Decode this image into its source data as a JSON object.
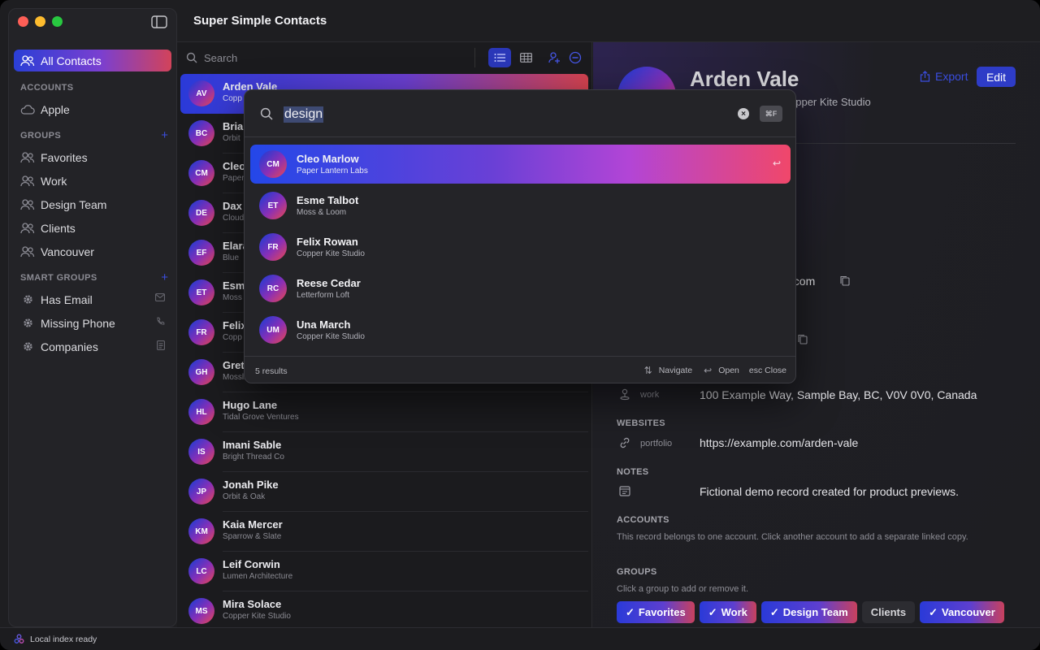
{
  "app": {
    "title": "Super Simple Contacts"
  },
  "sidebar": {
    "all_contacts": "All Contacts",
    "accounts_header": "ACCOUNTS",
    "accounts": [
      {
        "label": "Apple",
        "icon": "cloud-icon"
      }
    ],
    "groups_header": "GROUPS",
    "groups": [
      {
        "label": "Favorites",
        "icon": "people-icon"
      },
      {
        "label": "Work",
        "icon": "people-icon"
      },
      {
        "label": "Design Team",
        "icon": "people-icon"
      },
      {
        "label": "Clients",
        "icon": "people-icon"
      },
      {
        "label": "Vancouver",
        "icon": "people-icon"
      }
    ],
    "smart_groups_header": "SMART GROUPS",
    "smart_groups": [
      {
        "label": "Has Email",
        "icon": "gear-icon",
        "trail_icon": "envelope-icon"
      },
      {
        "label": "Missing Phone",
        "icon": "gear-icon",
        "trail_icon": "phone-icon"
      },
      {
        "label": "Companies",
        "icon": "gear-icon",
        "trail_icon": "document-icon"
      }
    ]
  },
  "list": {
    "search_placeholder": "Search",
    "contacts": [
      {
        "initials": "AV",
        "name": "Arden Vale",
        "company": "Copp"
      },
      {
        "initials": "BC",
        "name": "Brian",
        "company": "Orbit"
      },
      {
        "initials": "CM",
        "name": "Cleo",
        "company": "Paper"
      },
      {
        "initials": "DE",
        "name": "Dax",
        "company": "Cloud"
      },
      {
        "initials": "EF",
        "name": "Elara",
        "company": "Blue"
      },
      {
        "initials": "ET",
        "name": "Esm",
        "company": "Moss"
      },
      {
        "initials": "FR",
        "name": "Felix",
        "company": "Copp"
      },
      {
        "initials": "GH",
        "name": "Gret",
        "company": "Mossli"
      },
      {
        "initials": "HL",
        "name": "Hugo Lane",
        "company": "Tidal Grove Ventures"
      },
      {
        "initials": "IS",
        "name": "Imani Sable",
        "company": "Bright Thread Co"
      },
      {
        "initials": "JP",
        "name": "Jonah Pike",
        "company": "Orbit & Oak"
      },
      {
        "initials": "KM",
        "name": "Kaia Mercer",
        "company": "Sparrow & Slate"
      },
      {
        "initials": "LC",
        "name": "Leif Corwin",
        "company": "Lumen Architecture"
      },
      {
        "initials": "MS",
        "name": "Mira Solace",
        "company": "Copper Kite Studio"
      }
    ]
  },
  "detail": {
    "name": "Arden Vale",
    "company_fragment": "opper Kite Studio",
    "export_label": "Export",
    "edit_label": "Edit",
    "email_fragment": "le.com",
    "address": {
      "label": "work",
      "value": "100 Example Way, Sample Bay, BC, V0V 0V0, Canada"
    },
    "websites_header": "WEBSITES",
    "website": {
      "label": "portfolio",
      "value": "https://example.com/arden-vale"
    },
    "notes_header": "NOTES",
    "note": "Fictional demo record created for product previews.",
    "accounts_header": "ACCOUNTS",
    "accounts_note": "This record belongs to one account. Click another account to add a separate linked copy.",
    "groups_header": "GROUPS",
    "groups_note": "Click a group to add or remove it.",
    "group_chips": [
      {
        "label": "Favorites",
        "checked": true
      },
      {
        "label": "Work",
        "checked": true
      },
      {
        "label": "Design Team",
        "checked": true
      },
      {
        "label": "Clients",
        "checked": false
      },
      {
        "label": "Vancouver",
        "checked": true
      }
    ]
  },
  "palette": {
    "query": "design",
    "clear_icon": "x-circle-icon",
    "shortcut": "⌘F",
    "results": [
      {
        "initials": "CM",
        "name": "Cleo Marlow",
        "company": "Paper Lantern Labs"
      },
      {
        "initials": "ET",
        "name": "Esme Talbot",
        "company": "Moss & Loom"
      },
      {
        "initials": "FR",
        "name": "Felix Rowan",
        "company": "Copper Kite Studio"
      },
      {
        "initials": "RC",
        "name": "Reese Cedar",
        "company": "Letterform Loft"
      },
      {
        "initials": "UM",
        "name": "Una March",
        "company": "Copper Kite Studio"
      }
    ],
    "result_count": "5 results",
    "hint_navigate": "Navigate",
    "hint_open": "Open",
    "hint_close": "esc Close"
  },
  "status": {
    "text": "Local index ready"
  },
  "colors": {
    "accent": "#2e3cc7",
    "gradient_start": "#2447e8",
    "gradient_end": "#f0476a"
  }
}
